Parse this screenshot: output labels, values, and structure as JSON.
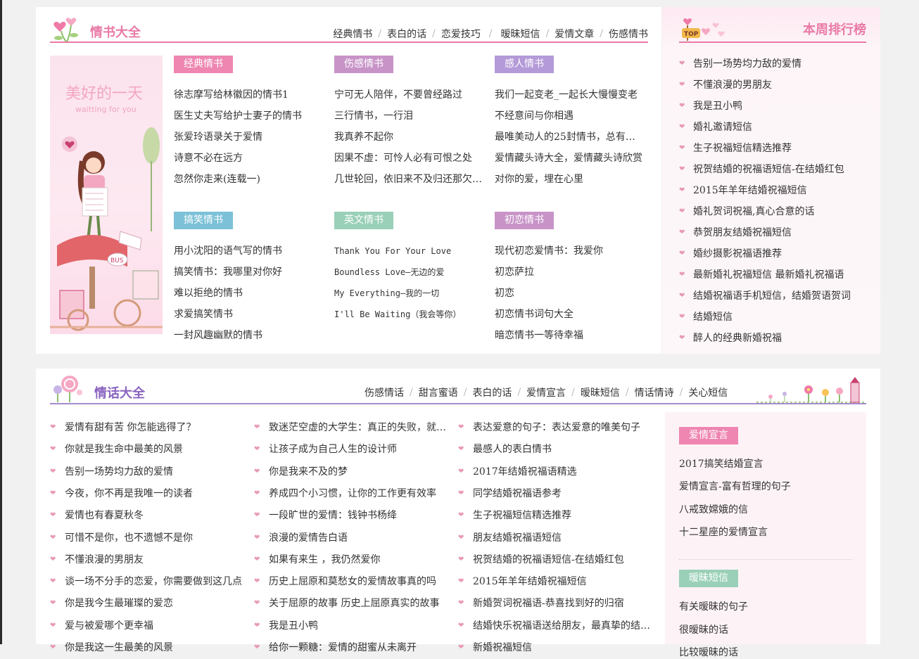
{
  "colors": {
    "pink": "#e97aa6",
    "purple": "#8a63c0",
    "link": "#333333"
  },
  "qingshu": {
    "title": "情书大全",
    "nav": [
      "经典情书",
      "表白的话",
      "恋爱技巧",
      "暧昧短信",
      "爱情文章",
      "伤感情书"
    ],
    "image": {
      "title": "美好的一天",
      "subtitle": "waitting for you",
      "bus": "BUS"
    },
    "columns": [
      {
        "label": "经典情书",
        "color": "#ee86b1",
        "items": [
          "徐志摩写给林徽因的情书1",
          "医生丈夫写给护士妻子的情书",
          "张爱玲语录关于爱情",
          "诗意不必在远方",
          "忽然你走来(连载一)"
        ]
      },
      {
        "label": "伤感情书",
        "color": "#c894c8",
        "items": [
          "宁可无人陪伴，不要曾经路过",
          "三行情书，一行泪",
          "我真养不起你",
          "因果不虚：可怜人必有可恨之处",
          "几世轮回，依旧来不及归还那欠你的情"
        ]
      },
      {
        "label": "感人情书",
        "color": "#b49ad8",
        "items": [
          "我们一起变老_一起长大慢慢变老",
          "不经意间与你相遇",
          "最唯美动人的25封情书，总有一封打动你",
          "爱情藏头诗大全，爱情藏头诗欣赏",
          "对你的爱，埋在心里"
        ]
      },
      {
        "label": "搞笑情书",
        "color": "#7cc1d8",
        "items": [
          "用小沈阳的语气写的情书",
          "搞笑情书：我哪里对你好",
          "难以拒绝的情书",
          "求爱搞笑情书",
          "一封风趣幽默的情书"
        ]
      },
      {
        "label": "英文情书",
        "color": "#9ad0b8",
        "items": [
          "Thank You For Your Love",
          "Boundless Love—无边的爱",
          "My Everything—我的一切",
          "I'll Be Waiting（我会等你）"
        ]
      },
      {
        "label": "初恋情书",
        "color": "#c894c8",
        "items": [
          "现代初恋爱情书：我爱你",
          "初恋萨拉",
          "初恋",
          "初恋情书词句大全",
          "暗恋情书一等待幸福"
        ]
      }
    ]
  },
  "ranking": {
    "title": "本周排行榜",
    "top_badge": "TOP",
    "items": [
      "告别一场势均力敌的爱情",
      "不懂浪漫的男朋友",
      "我是丑小鸭",
      "婚礼邀请短信",
      "生子祝福短信精选推荐",
      "祝贺结婚的祝福语短信-在结婚红包",
      "2015年羊年结婚祝福短信",
      "婚礼贺词祝福,真心合意的话",
      "恭贺朋友结婚祝福短信",
      "婚纱摄影祝福语推荐",
      "最新婚礼祝福短信 最新婚礼祝福语",
      "结婚祝福语手机短信，结婚贺语贺词",
      "结婚短信",
      "醉人的经典新婚祝福"
    ]
  },
  "qinghua": {
    "title": "情话大全",
    "nav": [
      "伤感情话",
      "甜言蜜语",
      "表白的话",
      "爱情宣言",
      "暧昧短信",
      "情话情诗",
      "关心短信"
    ],
    "columns": [
      [
        "爱情有甜有苦 你怎能逃得了？",
        "你就是我生命中最美的风景",
        "告别一场势均力敌的爱情",
        "今夜，你不再是我唯一的读者",
        "爱情也有春夏秋冬",
        "可惜不是你，也不遗憾不是你",
        "不懂浪漫的男朋友",
        "谈一场不分手的恋爱，你需要做到这几点",
        "你是我今生最璀璨的爱恋",
        "爱与被爱哪个更幸福",
        "你是我这一生最美的风景"
      ],
      [
        "致迷茫空虚的大学生：真正的失败，就是从不尝试",
        "让孩子成为自己人生的设计师",
        "你是我来不及的梦",
        "养成四个小习惯，让你的工作更有效率",
        "一段旷世的爱情：钱钟书杨绛",
        "浪漫的爱情告白语",
        "如果有来生 ，我仍然爱你",
        "历史上屈原和莫愁女的爱情故事真的吗",
        "关于屈原的故事 历史上屈原真实的故事",
        "我是丑小鸭",
        "给你一颗糖：爱情的甜蜜从未离开"
      ],
      [
        "表达爱意的句子：表达爱意的唯美句子",
        "最感人的表白情书",
        "2017年结婚祝福语精选",
        "同学结婚祝福语参考",
        "生子祝福短信精选推荐",
        "朋友结婚祝福语短信",
        "祝贺结婚的祝福语短信-在结婚红包",
        "2015年羊年结婚祝福短信",
        "新婚贺词祝福语-恭喜找到好的归宿",
        "结婚快乐祝福语送给朋友，最真挚的结婚祝福",
        "新婚祝福短信"
      ]
    ],
    "side": {
      "sections": [
        {
          "label": "爱情宣言",
          "color": "#ee86b1",
          "items": [
            "2017搞笑结婚宣言",
            "爱情宣言-富有哲理的句子",
            "八戒致嫦娥的信",
            "十二星座的爱情宣言"
          ]
        },
        {
          "label": "暧昧短信",
          "color": "#9ad0b8",
          "items": [
            "有关暧昧的句子",
            "很暧昧的话",
            "比较暧昧的话"
          ]
        }
      ]
    }
  }
}
